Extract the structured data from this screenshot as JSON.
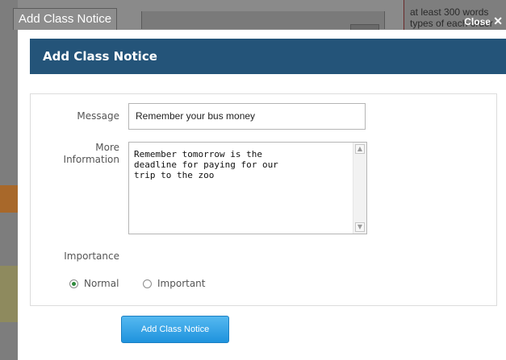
{
  "window": {
    "title": "Add Class Notice",
    "close_label": "Close",
    "close_glyph": "✕"
  },
  "background": {
    "right_text_line1": "at least 300 words",
    "right_text_line2": "types of each order"
  },
  "dialog": {
    "heading": "Add Class Notice",
    "header_color": "#245479",
    "fields": {
      "message_label": "Message",
      "message_value": "Remember your bus money",
      "info_label_line1": "More",
      "info_label_line2": "Information",
      "info_value": "Remember tomorrow is the\ndeadline for paying for our\ntrip to the zoo",
      "importance_label": "Importance"
    },
    "importance_options": [
      {
        "label": "Normal",
        "selected": true
      },
      {
        "label": "Important",
        "selected": false
      }
    ],
    "submit_label": "Add Class Notice",
    "accent_color": "#1f93dd"
  }
}
